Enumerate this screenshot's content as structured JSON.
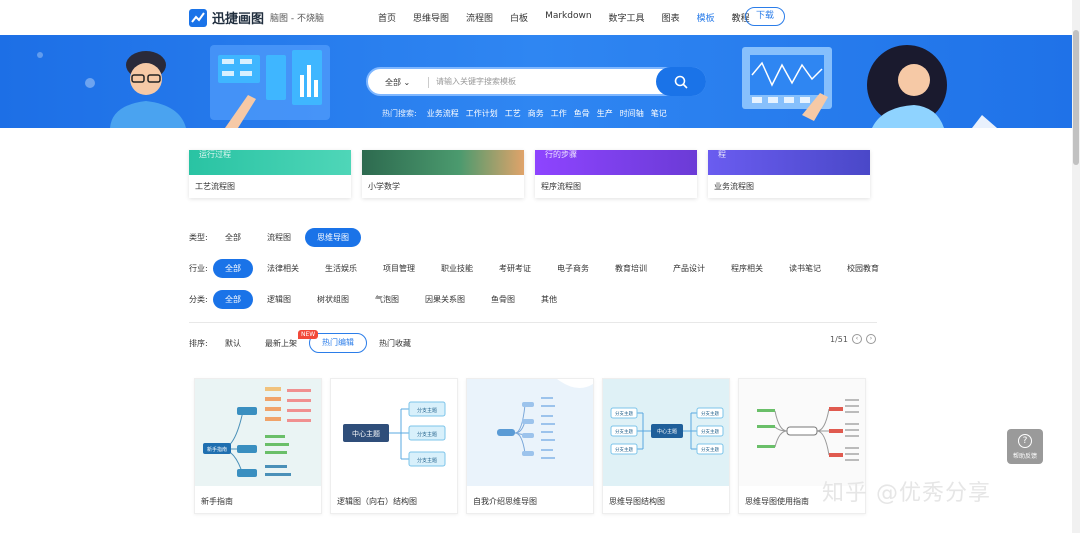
{
  "header": {
    "brand": "迅捷画图",
    "subtitle": "脑图 - 不烧脑",
    "nav": [
      "首页",
      "思维导图",
      "流程图",
      "白板",
      "Markdown",
      "数字工具",
      "图表",
      "模板",
      "教程"
    ],
    "active_nav": "模板",
    "download_label": "下载"
  },
  "hero": {
    "search_category": "全部",
    "search_placeholder": "请输入关键字搜索模板",
    "hot_label": "热门搜索:",
    "hot_terms": [
      "业务流程",
      "工作计划",
      "工艺",
      "商务",
      "工作",
      "鱼骨",
      "生产",
      "时间轴",
      "笔记"
    ]
  },
  "top_templates": [
    {
      "label": "工艺流程图",
      "thumb_text": "运行过程",
      "color": "#2ec4a6"
    },
    {
      "label": "小学数学",
      "thumb_text": "",
      "color": "#2d6a4f"
    },
    {
      "label": "程序流程图",
      "thumb_text": "行的步骤",
      "color": "#8e44ff"
    },
    {
      "label": "业务流程图",
      "thumb_text": "程",
      "color": "#5b5bd6"
    }
  ],
  "filters": {
    "type": {
      "label": "类型:",
      "options": [
        "全部",
        "流程图",
        "思维导图"
      ],
      "active": "思维导图"
    },
    "industry": {
      "label": "行业:",
      "options": [
        "全部",
        "法律相关",
        "生活娱乐",
        "项目管理",
        "职业技能",
        "考研考证",
        "电子商务",
        "教育培训",
        "产品设计",
        "程序相关",
        "读书笔记",
        "校园教育"
      ],
      "active": "全部"
    },
    "category": {
      "label": "分类:",
      "options": [
        "全部",
        "逻辑图",
        "树状组图",
        "气泡图",
        "因果关系图",
        "鱼骨图",
        "其他"
      ],
      "active": "全部"
    }
  },
  "sort": {
    "label": "排序:",
    "options": [
      "默认",
      "最新上架",
      "热门编辑",
      "热门收藏"
    ],
    "active": "热门编辑",
    "new_badge": "NEW"
  },
  "pager": {
    "text": "1/51",
    "prev_icon": "chevron-left-icon",
    "next_icon": "chevron-right-icon"
  },
  "mindmaps": [
    {
      "label": "新手指南",
      "center": "新手指南"
    },
    {
      "label": "逻辑图（向右）结构图",
      "center": "中心主题",
      "branch": "分支主题"
    },
    {
      "label": "自我介绍思维导图",
      "center": ""
    },
    {
      "label": "思维导图结构图",
      "center": "中心主题",
      "branch": "分支主题"
    },
    {
      "label": "思维导图使用指南",
      "center": ""
    }
  ],
  "help": {
    "label": "帮助反馈",
    "icon": "question-icon"
  },
  "watermark": "知乎 @优秀分享",
  "colors": {
    "primary": "#1a73e8",
    "hero": "#2f86f2",
    "badge": "#f24a3a"
  }
}
